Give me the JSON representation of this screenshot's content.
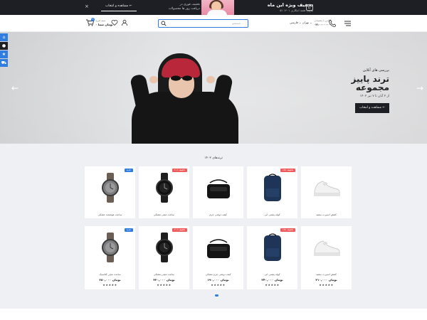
{
  "promo": {
    "close": "×",
    "cta": "مشاهده و انتخاب ←",
    "sub_line1": "تخفیف فوری در",
    "sub_line2": "دریافت روز ها محصولات",
    "title": "تخفیف ویژه این ماه",
    "title_sub": "۵٪ ۱۴۰۱ بیرون هفته ابتکاری",
    "badge": "۵٪"
  },
  "header": {
    "cart_count": "0",
    "cart_label": "سبد خرید",
    "cart_price": "۰ تومان شما",
    "search_placeholder": "جستجو...",
    "city": "تهران ⌄ فارسی ⌄",
    "phone_label": "تماس با پشتیبانی",
    "phone_number": "۰۲۱۰۰۰۰۰۰۰۰"
  },
  "hero": {
    "kicker": "بررسی های آنلاین",
    "title_line1": "ترند پاییز",
    "title_line2": "مجموعه",
    "date": "از ۲ آبان تا ۷ تیر ۱۴۰۲",
    "button": "مشاهده و انتخاب ←"
  },
  "section1": {
    "title": "ترندهای ۱۴۰۲",
    "cards": [
      {
        "tag": "جدید",
        "tag_color": "blue",
        "name": "ساعت هوشمند مشکی",
        "icon": "watch-grey-icon"
      },
      {
        "tag": "۲۰٪ تخفیف",
        "tag_color": "red",
        "name": "ساعت مچی مشکی",
        "icon": "watch-black-icon"
      },
      {
        "tag": "",
        "tag_color": "",
        "name": "کیف دوشی چرم",
        "icon": "bag-icon"
      },
      {
        "tag": "۱۵٪ تخفیف",
        "tag_color": "red",
        "name": "کوله پشتی آبی",
        "icon": "backpack-icon"
      },
      {
        "tag": "",
        "tag_color": "",
        "name": "کفش اسپرت سفید",
        "icon": "sneaker-icon"
      }
    ]
  },
  "section2": {
    "title": "ترندهای ۱۴۰۲",
    "cards": [
      {
        "tag": "جدید",
        "tag_color": "blue",
        "name": "ساعت مچی کلاسیک",
        "price": "۲۸۰,۰۰۰ تومان",
        "stars": "★★★★★",
        "icon": "watch-grey-icon"
      },
      {
        "tag": "۲۰٪ تخفیف",
        "tag_color": "red",
        "name": "ساعت مچی مشکی",
        "price": "۳۲۰,۰۰۰ تومان",
        "stars": "★★★★★",
        "icon": "watch-black-icon"
      },
      {
        "tag": "",
        "tag_color": "",
        "name": "کیف دوشی چرم مشکی",
        "price": "۱۹۰,۰۰۰ تومان",
        "stars": "★★★★★",
        "icon": "bag-icon"
      },
      {
        "tag": "۱۵٪ تخفیف",
        "tag_color": "red",
        "name": "کوله پشتی آبی",
        "price": "۲۴۰,۰۰۰ تومان",
        "stars": "★★★★★",
        "icon": "backpack-icon"
      },
      {
        "tag": "",
        "tag_color": "",
        "name": "کفش اسپرت سفید",
        "price": "۲۱۰,۰۰۰ تومان",
        "stars": "★★★★★",
        "icon": "sneaker-icon"
      }
    ]
  },
  "colors": {
    "accent": "#2f7de1",
    "dark": "#1d1f24",
    "sale": "#ef5b5b",
    "bg": "#eef0f3"
  }
}
